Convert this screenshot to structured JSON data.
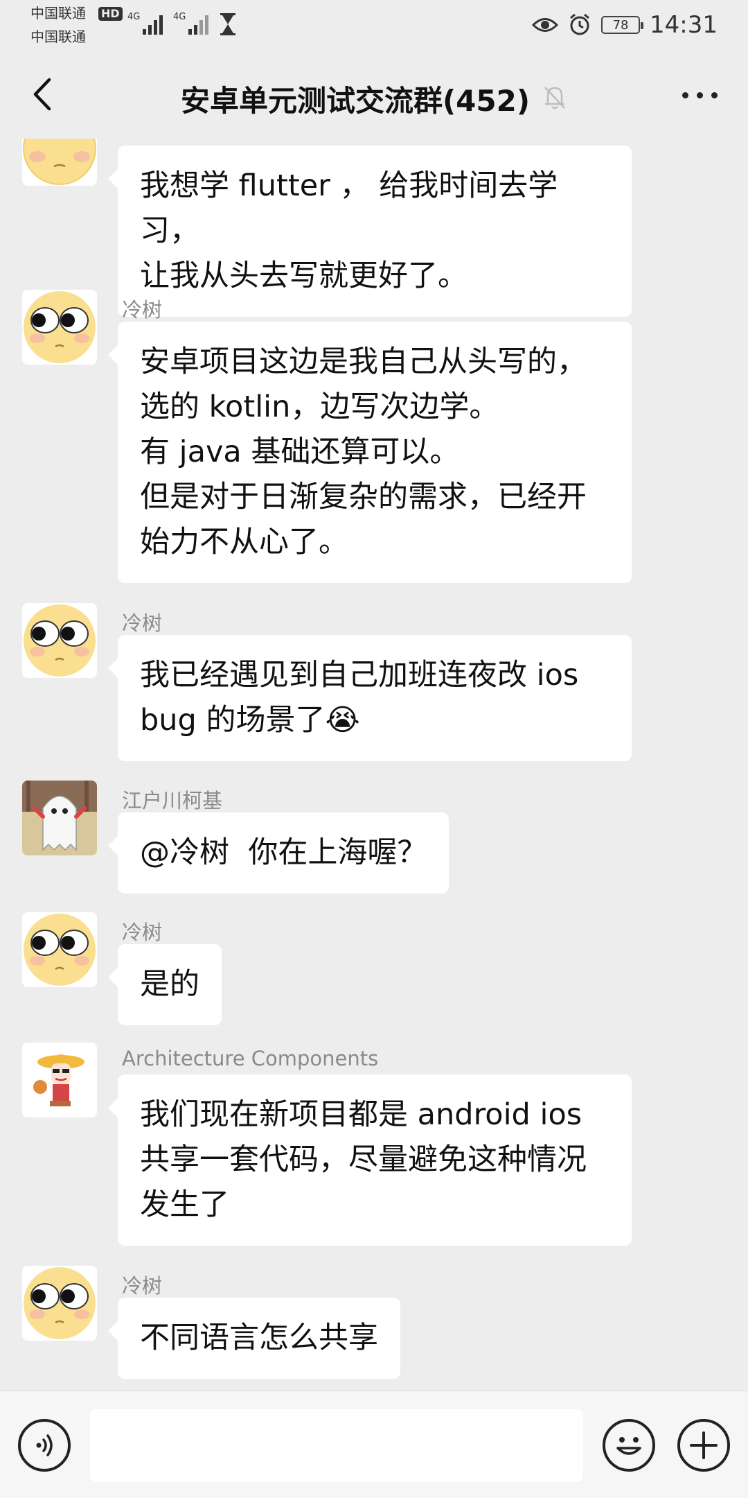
{
  "status_bar": {
    "carrier_1": "中国联通",
    "carrier_2": "中国联通",
    "hd_badge": "HD",
    "network_1": "4G",
    "network_2": "4G",
    "battery_level": "78",
    "time": "14:31"
  },
  "header": {
    "title": "安卓单元测试交流群(452)",
    "icons": [
      "back-arrow",
      "mute-bell",
      "more-dots"
    ]
  },
  "messages": [
    {
      "sender": "",
      "avatar": "yellow-face-emoji",
      "text": "我想学 flutter ， 给我时间去学习，\n让我从头去写就更好了。"
    },
    {
      "sender": "冷树",
      "avatar": "yellow-face-emoji",
      "text": "安卓项目这边是我自己从头写的，\n选的 kotlin，边写次边学。\n有 java 基础还算可以。\n但是对于日渐复杂的需求，已经开\n始力不从心了。"
    },
    {
      "sender": "冷树",
      "avatar": "yellow-face-emoji",
      "text": "我已经遇见到自己加班连夜改 ios\nbug 的场景了😭"
    },
    {
      "sender": "江户川柯基",
      "avatar": "ghost-cartoon",
      "text": "@冷树  你在上海喔？"
    },
    {
      "sender": "冷树",
      "avatar": "yellow-face-emoji",
      "text": "是的"
    },
    {
      "sender": "Architecture Components",
      "avatar": "hat-character-cartoon",
      "text": "我们现在新项目都是 android ios\n共享一套代码，尽量避免这种情况\n发生了"
    },
    {
      "sender": "冷树",
      "avatar": "yellow-face-emoji",
      "text": "不同语言怎么共享"
    }
  ],
  "input_bar": {
    "text_value": "",
    "icons": [
      "voice-icon",
      "emoji-icon",
      "plus-icon"
    ]
  },
  "colors": {
    "background": "#ededed",
    "bubble": "#ffffff",
    "sender_name": "#8a8a8a"
  }
}
